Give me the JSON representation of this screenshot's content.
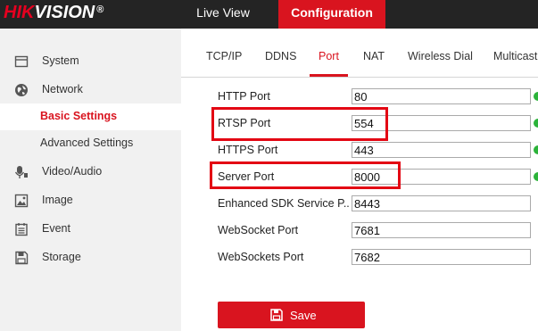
{
  "brand": {
    "logo_first": "HIK",
    "logo_rest": "VISION",
    "logo_mark": "®"
  },
  "top_nav": {
    "live_view": "Live View",
    "configuration": "Configuration"
  },
  "sidebar": {
    "items": [
      {
        "label": "System",
        "icon": "system-icon"
      },
      {
        "label": "Network",
        "icon": "network-icon"
      },
      {
        "label": "Basic Settings",
        "icon": ""
      },
      {
        "label": "Advanced Settings",
        "icon": ""
      },
      {
        "label": "Video/Audio",
        "icon": "video-audio-icon"
      },
      {
        "label": "Image",
        "icon": "image-icon"
      },
      {
        "label": "Event",
        "icon": "event-icon"
      },
      {
        "label": "Storage",
        "icon": "storage-icon"
      }
    ]
  },
  "tabs": [
    "TCP/IP",
    "DDNS",
    "Port",
    "NAT",
    "Wireless Dial",
    "Multicast"
  ],
  "ports": [
    {
      "label": "HTTP Port",
      "value": "80"
    },
    {
      "label": "RTSP Port",
      "value": "554"
    },
    {
      "label": "HTTPS Port",
      "value": "443"
    },
    {
      "label": "Server Port",
      "value": "8000"
    },
    {
      "label": "Enhanced SDK Service P...",
      "value": "8443"
    },
    {
      "label": "WebSocket Port",
      "value": "7681"
    },
    {
      "label": "WebSockets Port",
      "value": "7682"
    }
  ],
  "save": {
    "label": "Save"
  },
  "colors": {
    "accent": "#d9141f",
    "topbar": "#242424",
    "sidebar": "#f1f1f1",
    "valid": "#2cb33a",
    "highlight": "#e30613"
  }
}
